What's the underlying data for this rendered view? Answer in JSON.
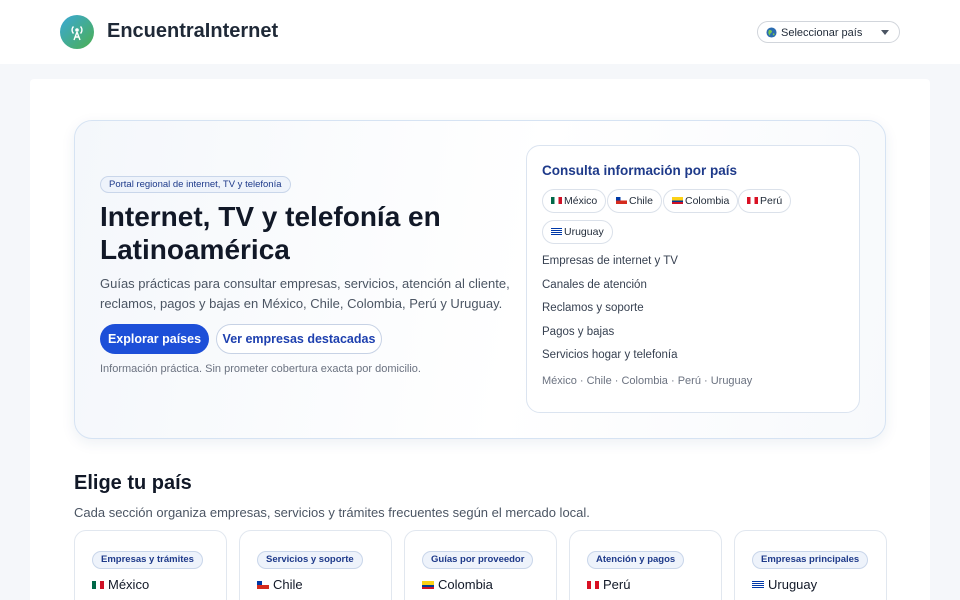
{
  "header": {
    "brand": "EncuentraInternet",
    "country_select": "Seleccionar país"
  },
  "hero": {
    "badge": "Portal regional de internet, TV y telefonía",
    "title": "Internet, TV y telefonía en Latinoamérica",
    "description": "Guías prácticas para consultar empresas, servicios, atención al cliente, reclamos, pagos y bajas en México, Chile, Colombia, Perú y Uruguay.",
    "primary_button": "Explorar países",
    "secondary_button": "Ver empresas destacadas",
    "note": "Información práctica. Sin prometer cobertura exacta por domicilio."
  },
  "info_panel": {
    "title": "Consulta información por país",
    "chips": [
      "México",
      "Chile",
      "Colombia",
      "Perú",
      "Uruguay"
    ],
    "links": [
      "Empresas de internet y TV",
      "Canales de atención",
      "Reclamos y soporte",
      "Pagos y bajas",
      "Servicios hogar y telefonía"
    ],
    "countries_line": "México · Chile · Colombia · Perú · Uruguay"
  },
  "countries_section": {
    "title": "Elige tu país",
    "description": "Cada sección organiza empresas, servicios y trámites frecuentes según el mercado local.",
    "cards": [
      {
        "badge": "Empresas y trámites",
        "name": "México"
      },
      {
        "badge": "Servicios y soporte",
        "name": "Chile"
      },
      {
        "badge": "Guías por proveedor",
        "name": "Colombia"
      },
      {
        "badge": "Atención y pagos",
        "name": "Perú"
      },
      {
        "badge": "Empresas principales",
        "name": "Uruguay"
      }
    ]
  },
  "icons": {
    "logo": "antenna-icon",
    "select": "globe-icon",
    "caret": "caret-down-icon"
  },
  "colors": {
    "primary": "#1d4fd8",
    "accent_text": "#1e3a8a"
  }
}
